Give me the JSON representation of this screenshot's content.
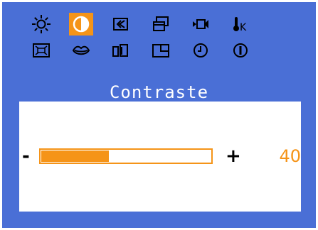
{
  "icons": [
    {
      "name": "brightness-icon",
      "selected": false
    },
    {
      "name": "contrast-icon",
      "selected": true
    },
    {
      "name": "position-icon",
      "selected": false
    },
    {
      "name": "size-icon",
      "selected": false
    },
    {
      "name": "video-icon",
      "selected": false
    },
    {
      "name": "color-temperature-icon",
      "label": "K",
      "selected": false
    },
    {
      "name": "image-fit-icon",
      "selected": false
    },
    {
      "name": "language-icon",
      "selected": false
    },
    {
      "name": "pip-icon",
      "selected": false
    },
    {
      "name": "window-icon",
      "selected": false
    },
    {
      "name": "timer-icon",
      "selected": false
    },
    {
      "name": "info-icon",
      "selected": false
    }
  ],
  "title": "Contraste",
  "slider": {
    "minus": "-",
    "plus": "+",
    "value": "40",
    "fraction": 0.4
  },
  "colors": {
    "background": "#4a6fd6",
    "accent": "#f59418",
    "panel": "#ffffff"
  }
}
